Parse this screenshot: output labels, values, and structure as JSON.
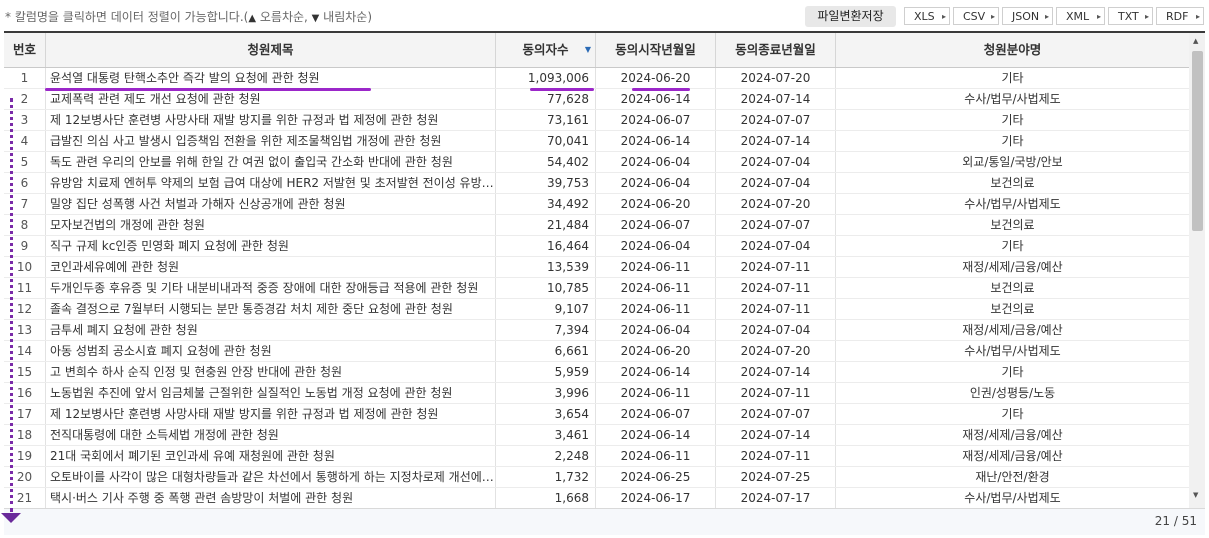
{
  "hint": {
    "text_prefix": "* 칼럼명을 클릭하면 데이터 정렬이 가능합니다.(",
    "asc_icon": "▲",
    "asc_label": " 오름차순, ",
    "desc_icon": "▼",
    "desc_label": " 내림차순)"
  },
  "toolbar": {
    "save_label": "파일변환저장",
    "formats": [
      "XLS",
      "CSV",
      "JSON",
      "XML",
      "TXT",
      "RDF"
    ]
  },
  "columns": {
    "no": "번호",
    "title": "청원제목",
    "count": "동의자수",
    "start": "동의시작년월일",
    "end": "동의종료년월일",
    "category": "청원분야명"
  },
  "sort": {
    "column": "count",
    "direction": "desc",
    "icon": "▼"
  },
  "rows": [
    {
      "no": "1",
      "title": "윤석열 대통령 탄핵소추안 즉각 발의 요청에 관한 청원",
      "count": "1,093,006",
      "start": "2024-06-20",
      "end": "2024-07-20",
      "category": "기타"
    },
    {
      "no": "2",
      "title": "교제폭력 관련 제도 개선 요청에 관한 청원",
      "count": "77,628",
      "start": "2024-06-14",
      "end": "2024-07-14",
      "category": "수사/법무/사법제도"
    },
    {
      "no": "3",
      "title": "제 12보병사단 훈련병 사망사태 재발 방지를 위한 규정과 법 제정에 관한 청원",
      "count": "73,161",
      "start": "2024-06-07",
      "end": "2024-07-07",
      "category": "기타"
    },
    {
      "no": "4",
      "title": "급발진 의심 사고 발생시 입증책임 전환을 위한 제조물책임법 개정에 관한 청원",
      "count": "70,041",
      "start": "2024-06-14",
      "end": "2024-07-14",
      "category": "기타"
    },
    {
      "no": "5",
      "title": "독도 관련 우리의 안보를 위해 한일 간 여권 없이 출입국 간소화 반대에 관한 청원",
      "count": "54,402",
      "start": "2024-06-04",
      "end": "2024-07-04",
      "category": "외교/통일/국방/안보"
    },
    {
      "no": "6",
      "title": "유방암 치료제 엔허투 약제의 보험 급여 대상에 HER2 저발현 및 초저발현 전이성 유방암 환자 포함 요청에 관한 청원",
      "count": "39,753",
      "start": "2024-06-04",
      "end": "2024-07-04",
      "category": "보건의료"
    },
    {
      "no": "7",
      "title": "밀양 집단 성폭행 사건 처벌과 가해자 신상공개에 관한 청원",
      "count": "34,492",
      "start": "2024-06-20",
      "end": "2024-07-20",
      "category": "수사/법무/사법제도"
    },
    {
      "no": "8",
      "title": "모자보건법의 개정에 관한 청원",
      "count": "21,484",
      "start": "2024-06-07",
      "end": "2024-07-07",
      "category": "보건의료"
    },
    {
      "no": "9",
      "title": "직구 규제 kc인증 민영화 폐지 요청에 관한 청원",
      "count": "16,464",
      "start": "2024-06-04",
      "end": "2024-07-04",
      "category": "기타"
    },
    {
      "no": "10",
      "title": "코인과세유예에 관한 청원",
      "count": "13,539",
      "start": "2024-06-11",
      "end": "2024-07-11",
      "category": "재정/세제/금융/예산"
    },
    {
      "no": "11",
      "title": "두개인두종 후유증 및 기타 내분비내과적 중증 장애에 대한 장애등급 적용에 관한 청원",
      "count": "10,785",
      "start": "2024-06-11",
      "end": "2024-07-11",
      "category": "보건의료"
    },
    {
      "no": "12",
      "title": "졸속 결정으로 7월부터 시행되는 분만 통증경감 처치 제한 중단 요청에 관한 청원",
      "count": "9,107",
      "start": "2024-06-11",
      "end": "2024-07-11",
      "category": "보건의료"
    },
    {
      "no": "13",
      "title": "금투세 폐지 요청에 관한 청원",
      "count": "7,394",
      "start": "2024-06-04",
      "end": "2024-07-04",
      "category": "재정/세제/금융/예산"
    },
    {
      "no": "14",
      "title": "아동 성범죄 공소시효 폐지 요청에 관한 청원",
      "count": "6,661",
      "start": "2024-06-20",
      "end": "2024-07-20",
      "category": "수사/법무/사법제도"
    },
    {
      "no": "15",
      "title": "고 변희수 하사 순직 인정 및 현충원 안장 반대에 관한 청원",
      "count": "5,959",
      "start": "2024-06-14",
      "end": "2024-07-14",
      "category": "기타"
    },
    {
      "no": "16",
      "title": "노동법원 추진에 앞서 임금체불 근절위한 실질적인 노동법 개정 요청에 관한 청원",
      "count": "3,996",
      "start": "2024-06-11",
      "end": "2024-07-11",
      "category": "인권/성평등/노동"
    },
    {
      "no": "17",
      "title": "제 12보병사단 훈련병 사망사태 재발 방지를 위한 규정과 법 제정에 관한 청원",
      "count": "3,654",
      "start": "2024-06-07",
      "end": "2024-07-07",
      "category": "기타"
    },
    {
      "no": "18",
      "title": "전직대통령에 대한 소득세법 개정에 관한 청원",
      "count": "3,461",
      "start": "2024-06-14",
      "end": "2024-07-14",
      "category": "재정/세제/금융/예산"
    },
    {
      "no": "19",
      "title": "21대 국회에서 폐기된 코인과세 유예 재청원에 관한 청원",
      "count": "2,248",
      "start": "2024-06-11",
      "end": "2024-07-11",
      "category": "재정/세제/금융/예산"
    },
    {
      "no": "20",
      "title": "오토바이를 사각이 많은 대형차량들과 같은 차선에서 통행하게 하는 지정차로제 개선에 관한 청원",
      "count": "1,732",
      "start": "2024-06-25",
      "end": "2024-07-25",
      "category": "재난/안전/환경"
    },
    {
      "no": "21",
      "title": "택시·버스 기사 주행 중 폭행 관련 솜방망이 처벌에 관한 청원",
      "count": "1,668",
      "start": "2024-06-17",
      "end": "2024-07-17",
      "category": "수사/법무/사법제도"
    }
  ],
  "footer": {
    "record_count": "21 / 51"
  },
  "colors": {
    "highlight": "#9b27c9",
    "header_bg": "#f4f4f4",
    "sort_icon": "#2a6ab5"
  }
}
